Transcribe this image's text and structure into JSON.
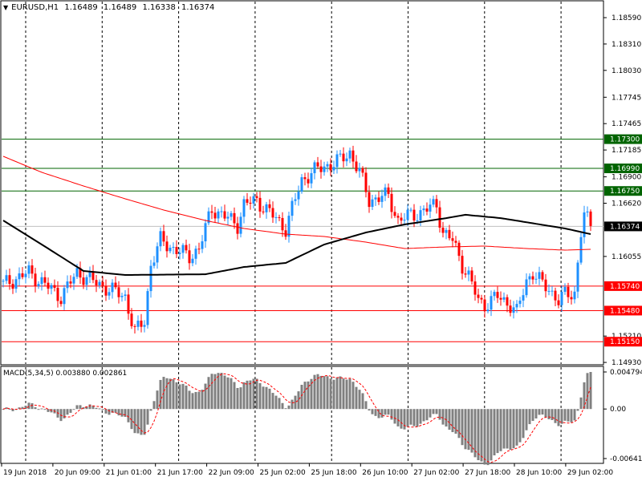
{
  "header": {
    "symbol": "EURUSD,H1",
    "open": "1.16489",
    "high": "1.16489",
    "low": "1.16338",
    "close": "1.16374"
  },
  "macd_panel": {
    "label": "MACD(5,34,5)",
    "main": "0.003880",
    "signal": "0.002861"
  },
  "colors": {
    "bull": "#1e90ff",
    "bear": "#ff0000",
    "ma_slow": "#000000",
    "ma_fast": "#ff0000",
    "resistance": "#006400",
    "support": "#ff0000",
    "hist": "#808080"
  },
  "chart_data": {
    "type": "candlestick",
    "title": "EURUSD,H1",
    "ylim": [
      1.1493,
      1.1859
    ],
    "price_ticks": [
      "1.18590",
      "1.18310",
      "1.18030",
      "1.17745",
      "1.17465",
      "1.17185",
      "1.16900",
      "1.16620",
      "1.16055",
      "1.15210",
      "1.14930"
    ],
    "level_lines": [
      {
        "price": 1.173,
        "label": "1.17300",
        "kind": "resistance"
      },
      {
        "price": 1.1699,
        "label": "1.16990",
        "kind": "resistance"
      },
      {
        "price": 1.1675,
        "label": "1.16750",
        "kind": "resistance"
      },
      {
        "price": 1.16374,
        "label": "1.16374",
        "kind": "current"
      },
      {
        "price": 1.1574,
        "label": "1.15740",
        "kind": "support"
      },
      {
        "price": 1.1548,
        "label": "1.15480",
        "kind": "support"
      },
      {
        "price": 1.1515,
        "label": "1.15150",
        "kind": "support"
      }
    ],
    "bar_count": 184,
    "close_path": [
      [
        0,
        1.15756
      ],
      [
        8,
        1.15884
      ],
      [
        18,
        1.15629
      ],
      [
        23,
        1.15884
      ],
      [
        30,
        1.15756
      ],
      [
        38,
        1.15629
      ],
      [
        41,
        1.15246
      ],
      [
        44,
        1.15374
      ],
      [
        46,
        1.15969
      ],
      [
        49,
        1.16224
      ],
      [
        53,
        1.16139
      ],
      [
        58,
        1.16054
      ],
      [
        61,
        1.16139
      ],
      [
        65,
        1.16565
      ],
      [
        69,
        1.1648
      ],
      [
        73,
        1.16394
      ],
      [
        75,
        1.16607
      ],
      [
        79,
        1.1665
      ],
      [
        83,
        1.16522
      ],
      [
        88,
        1.16352
      ],
      [
        90,
        1.16565
      ],
      [
        93,
        1.16862
      ],
      [
        96,
        1.16948
      ],
      [
        100,
        1.17007
      ],
      [
        105,
        1.17075
      ],
      [
        108,
        1.1716
      ],
      [
        111,
        1.16948
      ],
      [
        114,
        1.1665
      ],
      [
        118,
        1.16692
      ],
      [
        120,
        1.16692
      ],
      [
        123,
        1.16437
      ],
      [
        126,
        1.1648
      ],
      [
        130,
        1.16522
      ],
      [
        135,
        1.16607
      ],
      [
        137,
        1.16309
      ],
      [
        140,
        1.16224
      ],
      [
        143,
        1.15969
      ],
      [
        145,
        1.15841
      ],
      [
        148,
        1.15586
      ],
      [
        150,
        1.15544
      ],
      [
        154,
        1.15629
      ],
      [
        158,
        1.15544
      ],
      [
        160,
        1.15458
      ],
      [
        163,
        1.15799
      ],
      [
        165,
        1.15884
      ],
      [
        168,
        1.15756
      ],
      [
        170,
        1.15714
      ],
      [
        173,
        1.15586
      ],
      [
        175,
        1.15646
      ],
      [
        178,
        1.15671
      ],
      [
        180,
        1.16309
      ],
      [
        181,
        1.16497
      ],
      [
        183,
        1.16374
      ]
    ],
    "ma_slow_path": [
      [
        0,
        1.16437
      ],
      [
        12,
        1.16182
      ],
      [
        25,
        1.15901
      ],
      [
        38,
        1.15858
      ],
      [
        63,
        1.15866
      ],
      [
        75,
        1.15943
      ],
      [
        88,
        1.15986
      ],
      [
        100,
        1.16182
      ],
      [
        113,
        1.16309
      ],
      [
        125,
        1.16394
      ],
      [
        138,
        1.16462
      ],
      [
        144,
        1.16497
      ],
      [
        155,
        1.16462
      ],
      [
        175,
        1.16352
      ],
      [
        183,
        1.16292
      ]
    ],
    "ma_fast_path": [
      [
        0,
        1.17118
      ],
      [
        12,
        1.16948
      ],
      [
        25,
        1.16803
      ],
      [
        38,
        1.16667
      ],
      [
        50,
        1.16548
      ],
      [
        63,
        1.16437
      ],
      [
        75,
        1.16352
      ],
      [
        88,
        1.16292
      ],
      [
        100,
        1.16267
      ],
      [
        113,
        1.16207
      ],
      [
        125,
        1.16139
      ],
      [
        138,
        1.16156
      ],
      [
        150,
        1.16165
      ],
      [
        163,
        1.16139
      ],
      [
        175,
        1.16122
      ],
      [
        183,
        1.16131
      ]
    ],
    "macd": {
      "ylim": [
        -0.006414,
        0.004794
      ],
      "ticks": [
        "0.004794",
        "0.00",
        "-0.006414"
      ]
    },
    "time_labels": [
      "19 Jun 2018",
      "20 Jun 09:00",
      "21 Jun 01:00",
      "21 Jun 17:00",
      "22 Jun 09:00",
      "25 Jun 02:00",
      "25 Jun 18:00",
      "26 Jun 10:00",
      "27 Jun 02:00",
      "27 Jun 18:00",
      "28 Jun 10:00",
      "29 Jun 02:00"
    ]
  }
}
